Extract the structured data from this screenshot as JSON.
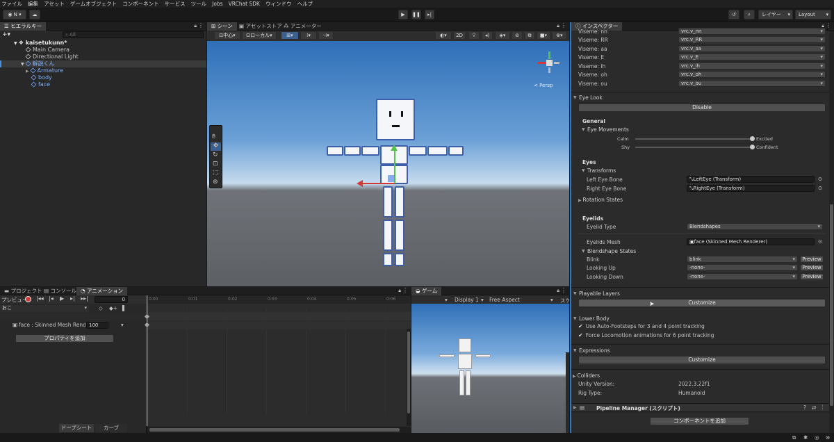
{
  "menubar": [
    "ファイル",
    "編集",
    "アセット",
    "ゲームオブジェクト",
    "コンポーネント",
    "サービス",
    "ツール",
    "Jobs",
    "VRChat SDK",
    "ウィンドウ",
    "ヘルプ"
  ],
  "toolbar": {
    "account": "N",
    "layers": "レイヤー",
    "layout": "Layout"
  },
  "hierarchy": {
    "tab": "ヒエラルキー",
    "search_placeholder": "All",
    "scene": "kaisetukunn*",
    "items": [
      "Main Camera",
      "Directional Light",
      "解説くん",
      "Armature",
      "body",
      "face"
    ]
  },
  "scene_view": {
    "tabs": [
      "シーン",
      "アセットストア",
      "アニメーター"
    ],
    "pivot": "中心",
    "space": "ローカル",
    "mode_2d": "2D",
    "persp": "< Persp"
  },
  "bottom_tabs": [
    "プロジェクト",
    "コンソール",
    "アニメーション"
  ],
  "animation": {
    "preview": "プレビュー",
    "frame": "0",
    "clip": "おこ",
    "property": "face : Skinned Mesh Rende",
    "property_value": "100",
    "add_property": "プロパティを追加",
    "timeline_ticks": [
      "0:00",
      "0:01",
      "0:02",
      "0:03",
      "0:04",
      "0:05",
      "0:06"
    ],
    "dopesheet": "ドープシート",
    "curves": "カーブ"
  },
  "game_view": {
    "tab": "ゲーム",
    "display": "Display 1",
    "aspect": "Free Aspect",
    "scale": "スケ"
  },
  "inspector": {
    "tab": "インスペクター",
    "visemes": [
      {
        "label": "Viseme: nn",
        "value": "vrc.v_nn"
      },
      {
        "label": "Viseme: RR",
        "value": "vrc.v_RR"
      },
      {
        "label": "Viseme: aa",
        "value": "vrc.v_aa"
      },
      {
        "label": "Viseme: E",
        "value": "vrc.v_E"
      },
      {
        "label": "Viseme: ih",
        "value": "vrc.v_ih"
      },
      {
        "label": "Viseme: oh",
        "value": "vrc.v_oh"
      },
      {
        "label": "Viseme: ou",
        "value": "vrc.v_ou"
      }
    ],
    "eye_look": "Eye Look",
    "disable": "Disable",
    "general": "General",
    "eye_movements": "Eye Movements",
    "calm": "Calm",
    "excited": "Excited",
    "shy": "Shy",
    "confident": "Confident",
    "calm_excited_value": 1.0,
    "shy_confident_value": 1.0,
    "eyes": "Eyes",
    "transforms": "Transforms",
    "left_eye_bone": "Left Eye Bone",
    "left_eye_value": "LeftEye (Transform)",
    "right_eye_bone": "Right Eye Bone",
    "right_eye_value": "RightEye (Transform)",
    "rotation_states": "Rotation States",
    "eyelids": "Eyelids",
    "eyelid_type": "Eyelid Type",
    "eyelid_type_value": "Blendshapes",
    "eyelids_mesh": "Eyelids Mesh",
    "eyelids_mesh_value": "face (Skinned Mesh Renderer)",
    "blendshape_states": "Blendshape States",
    "blink": "Blink",
    "blink_value": "blink",
    "looking_up": "Looking Up",
    "looking_up_value": "-none-",
    "looking_down": "Looking Down",
    "looking_down_value": "-none-",
    "preview_btn": "Preview",
    "playable_layers": "Playable Layers",
    "customize": "Customize",
    "lower_body": "Lower Body",
    "auto_footsteps": "Use Auto-Footsteps for 3 and 4 point tracking",
    "force_locomotion": "Force Locomotion animations for 6 point tracking",
    "expressions": "Expressions",
    "colliders": "Colliders",
    "unity_version_label": "Unity Version:",
    "unity_version": "2022.3.22f1",
    "rig_type_label": "Rig Type:",
    "rig_type": "Humanoid",
    "pipeline_manager": "Pipeline Manager (スクリプト)",
    "add_component": "コンポーネントを追加"
  }
}
